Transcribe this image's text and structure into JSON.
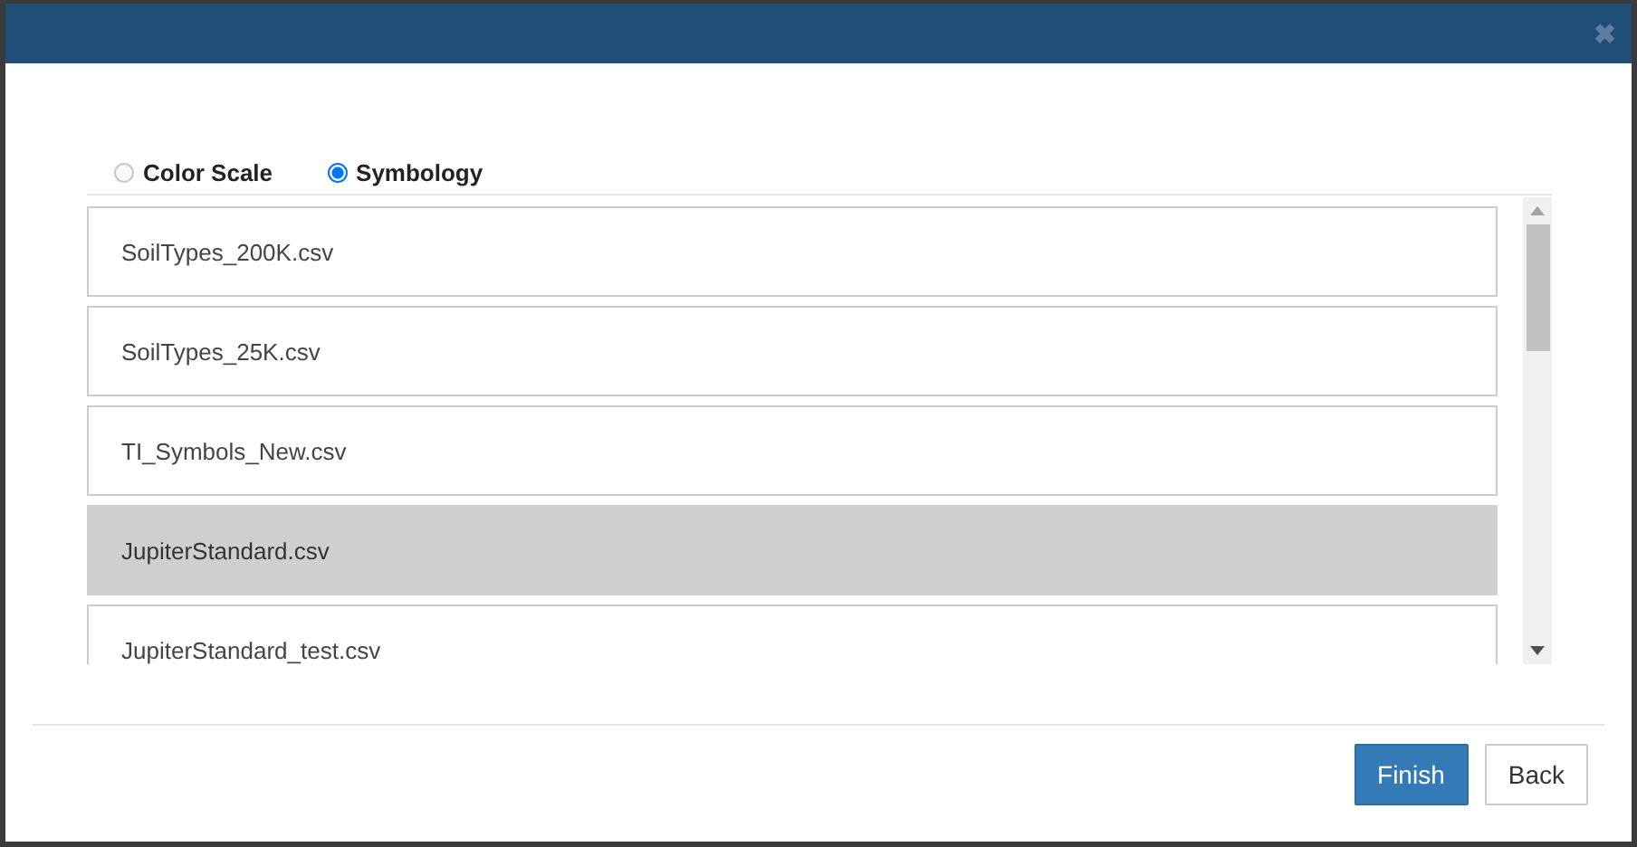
{
  "dialog": {
    "close_glyph": "✖"
  },
  "modes": [
    {
      "label": "Color Scale",
      "selected": false
    },
    {
      "label": "Symbology",
      "selected": true
    }
  ],
  "files": [
    {
      "name": "SoilTypes_200K.csv",
      "selected": false
    },
    {
      "name": "SoilTypes_25K.csv",
      "selected": false
    },
    {
      "name": "TI_Symbols_New.csv",
      "selected": false
    },
    {
      "name": "JupiterStandard.csv",
      "selected": true
    },
    {
      "name": "JupiterStandard_test.csv",
      "selected": false
    }
  ],
  "buttons": [
    {
      "label": "Finish",
      "kind": "primary"
    },
    {
      "label": "Back",
      "kind": "default"
    }
  ]
}
